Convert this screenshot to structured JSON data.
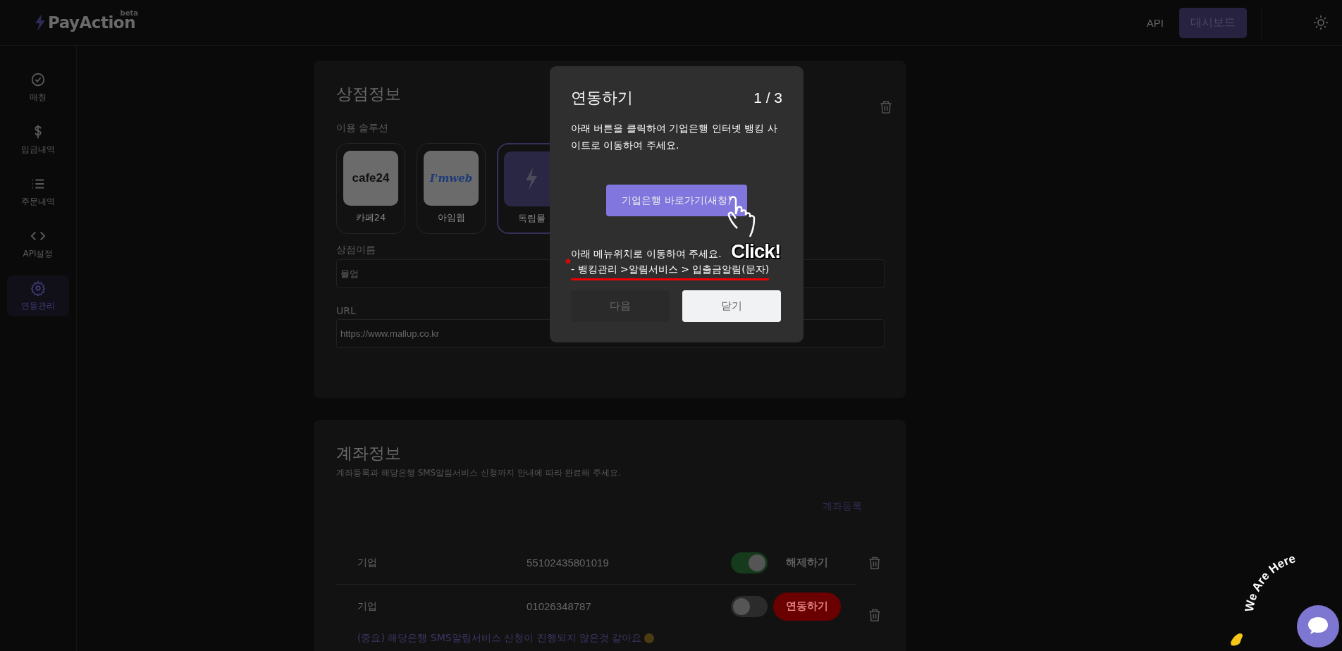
{
  "header": {
    "logo": "PayAction",
    "logo_badge": "beta",
    "nav_link": "API",
    "dashboard_button": "대시보드"
  },
  "sidebar": {
    "items": [
      {
        "label": "매칭",
        "kind": "check",
        "selected": false
      },
      {
        "label": "입금내역",
        "kind": "dollar",
        "selected": false
      },
      {
        "label": "주문내역",
        "kind": "list",
        "selected": false
      },
      {
        "label": "API설정",
        "kind": "code",
        "selected": false
      },
      {
        "label": "연동관리",
        "kind": "gear",
        "selected": true
      }
    ]
  },
  "store_info": {
    "title": "상점정보",
    "solution_label": "이용 솔루션",
    "solutions": [
      {
        "label": "카페24",
        "kind": "cafe24",
        "logo_text": "cafe24",
        "selected": false
      },
      {
        "label": "아임웹",
        "kind": "imweb",
        "logo_text": "I'mweb",
        "selected": false
      },
      {
        "label": "독립몰",
        "kind": "own",
        "selected": true
      }
    ],
    "name_label": "상점이름",
    "name_value": "몰업",
    "url_label": "URL",
    "url_value": "https://www.mallup.co.kr"
  },
  "account_info": {
    "title": "계좌정보",
    "subtitle": "계좌등록과 해당은행 SMS알림서비스 신청까지 안내에 따라 완료해 주세요.",
    "register_link": "계좌등록",
    "accounts": [
      {
        "bank": "기업",
        "number": "55102435801019",
        "on": true,
        "kind": "release",
        "action": "해제하기"
      },
      {
        "bank": "기업",
        "number": "01026348787",
        "on": false,
        "kind": "link",
        "action": "연동하기",
        "warning": "(중요) 해당은행 SMS알림서비스 신청이 진행되지 않은것 같아요"
      }
    ]
  },
  "modal": {
    "title": "연동하기",
    "step": "1 / 3",
    "instruction": "아래 버튼을 클릭하여 기업은행 인터넷 뱅킹 사이트로 이동하여 주세요.",
    "link_button": "기업은행 바로가기(새창)",
    "click_label": "Click!",
    "menu_hint": "아래 메뉴위치로 이동하여 주세요.",
    "asterisk": "*",
    "menu_path": "- 뱅킹관리 >알림서비스 > 입출금알림(문자)",
    "buttons": [
      {
        "label": "다음",
        "disabled": true
      },
      {
        "label": "닫기",
        "disabled": false
      }
    ]
  },
  "chat": {
    "label": "We Are Here"
  }
}
